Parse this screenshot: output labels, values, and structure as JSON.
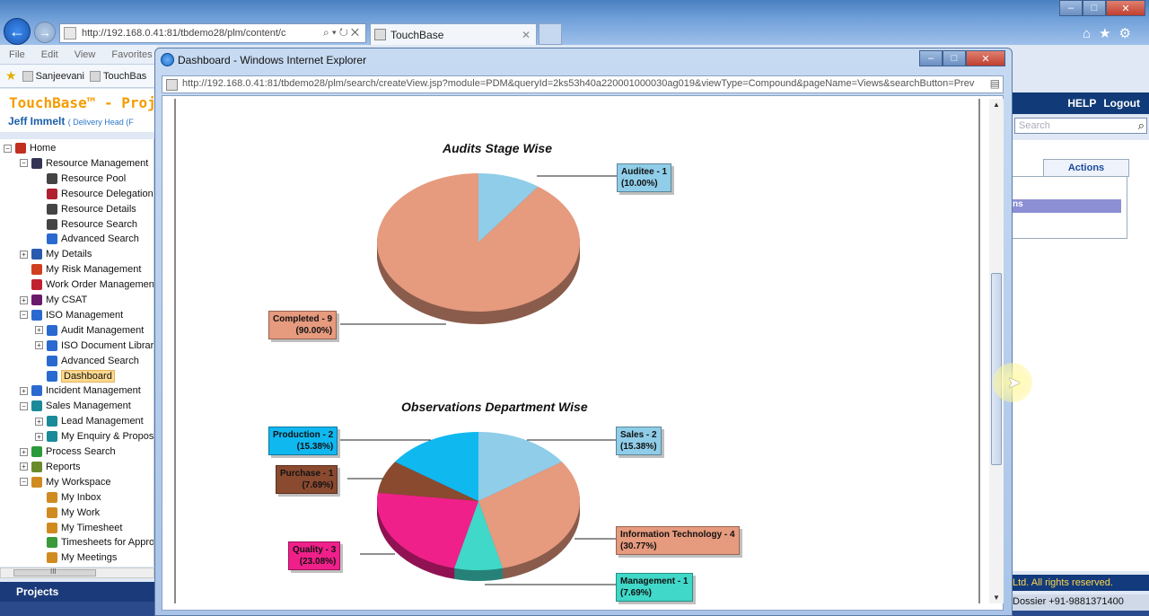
{
  "browser": {
    "address": "http://192.168.0.41:81/tbdemo28/plm/content/c",
    "tab_title": "TouchBase",
    "menu": [
      "File",
      "Edit",
      "View",
      "Favorites"
    ],
    "favorites": [
      "Sanjeevani",
      "TouchBas"
    ],
    "right_icons": [
      "home-icon",
      "star-icon",
      "gear-icon"
    ]
  },
  "app": {
    "brand": "TouchBase™ - Proje",
    "user_name": "Jeff Immelt",
    "user_role": "( Delivery Head (F",
    "help": "HELP",
    "logout": "Logout",
    "search_placeholder": "Search",
    "actions_label": "Actions",
    "actions_highlight": "ns",
    "projects_tab": "Projects",
    "copyright": "Ltd. All rights reserved.",
    "dossier": "Dossier +91-9881371400",
    "scroll_glyph": "III"
  },
  "tree": [
    {
      "label": "Home",
      "icon": "home-icon",
      "color": "#c03020",
      "level": 0,
      "toggle": "−"
    },
    {
      "label": "Resource Management",
      "icon": "resource-management-icon",
      "color": "#333355",
      "level": 1,
      "toggle": "−"
    },
    {
      "label": "Resource Pool",
      "icon": "people-icon",
      "color": "#444",
      "level": 2,
      "toggle": ""
    },
    {
      "label": "Resource Delegation",
      "icon": "delegation-icon",
      "color": "#b02030",
      "level": 2,
      "toggle": ""
    },
    {
      "label": "Resource Details",
      "icon": "people-icon",
      "color": "#444",
      "level": 2,
      "toggle": ""
    },
    {
      "label": "Resource Search",
      "icon": "people-icon",
      "color": "#444",
      "level": 2,
      "toggle": ""
    },
    {
      "label": "Advanced Search",
      "icon": "search-icon",
      "color": "#2a6ad0",
      "level": 2,
      "toggle": ""
    },
    {
      "label": "My Details",
      "icon": "details-icon",
      "color": "#2a5ab0",
      "level": 1,
      "toggle": "+"
    },
    {
      "label": "My Risk Management",
      "icon": "risk-icon",
      "color": "#d04020",
      "level": 1,
      "toggle": ""
    },
    {
      "label": "Work Order Management",
      "icon": "work-order-icon",
      "color": "#c02030",
      "level": 1,
      "toggle": ""
    },
    {
      "label": "My CSAT",
      "icon": "csat-icon",
      "color": "#6a1a6a",
      "level": 1,
      "toggle": "+"
    },
    {
      "label": "ISO Management",
      "icon": "iso-icon",
      "color": "#2a6ad0",
      "level": 1,
      "toggle": "−"
    },
    {
      "label": "Audit Management",
      "icon": "audit-icon",
      "color": "#2a6ad0",
      "level": 2,
      "toggle": "+"
    },
    {
      "label": "ISO Document Library",
      "icon": "document-icon",
      "color": "#2a6ad0",
      "level": 2,
      "toggle": "+"
    },
    {
      "label": "Advanced Search",
      "icon": "search-icon",
      "color": "#2a6ad0",
      "level": 2,
      "toggle": ""
    },
    {
      "label": "Dashboard",
      "icon": "dashboard-icon",
      "color": "#2a6ad0",
      "level": 2,
      "toggle": "",
      "selected": true
    },
    {
      "label": "Incident Management",
      "icon": "incident-icon",
      "color": "#2a6ad0",
      "level": 1,
      "toggle": "+"
    },
    {
      "label": "Sales Management",
      "icon": "sales-icon",
      "color": "#1a8a9a",
      "level": 1,
      "toggle": "−"
    },
    {
      "label": "Lead Management",
      "icon": "lead-icon",
      "color": "#1a8a9a",
      "level": 2,
      "toggle": "+"
    },
    {
      "label": "My Enquiry & Proposa",
      "icon": "enquiry-icon",
      "color": "#1a8a9a",
      "level": 2,
      "toggle": "+"
    },
    {
      "label": "Process Search",
      "icon": "process-icon",
      "color": "#2a9a3a",
      "level": 1,
      "toggle": "+"
    },
    {
      "label": "Reports",
      "icon": "reports-icon",
      "color": "#6a8a2a",
      "level": 1,
      "toggle": "+"
    },
    {
      "label": "My Workspace",
      "icon": "workspace-icon",
      "color": "#d08a20",
      "level": 1,
      "toggle": "−"
    },
    {
      "label": "My Inbox",
      "icon": "inbox-icon",
      "color": "#d08a20",
      "level": 2,
      "toggle": ""
    },
    {
      "label": "My Work",
      "icon": "work-icon",
      "color": "#d08a20",
      "level": 2,
      "toggle": ""
    },
    {
      "label": "My Timesheet",
      "icon": "timesheet-icon",
      "color": "#d08a20",
      "level": 2,
      "toggle": ""
    },
    {
      "label": "Timesheets for Approv",
      "icon": "approval-icon",
      "color": "#3a9a3a",
      "level": 2,
      "toggle": ""
    },
    {
      "label": "My Meetings",
      "icon": "meetings-icon",
      "color": "#d08a20",
      "level": 2,
      "toggle": ""
    }
  ],
  "popup": {
    "title": "Dashboard - Windows Internet Explorer",
    "address": "http://192.168.0.41:81/tbdemo28/plm/search/createView.jsp?module=PDM&queryId=2ks53h40a220001000030ag019&viewType=Compound&pageName=Views&searchButton=Prev"
  },
  "chart_data": [
    {
      "type": "pie",
      "title": "Audits Stage Wise",
      "slices": [
        {
          "label": "Auditee - 1",
          "value": 1,
          "percent": "(10.00%)",
          "color": "#8fcde8"
        },
        {
          "label": "Completed - 9",
          "value": 9,
          "percent": "(90.00%)",
          "color": "#e69a7e"
        }
      ]
    },
    {
      "type": "pie",
      "title": "Observations Department Wise",
      "slices": [
        {
          "label": "Sales - 2",
          "value": 2,
          "percent": "(15.38%)",
          "color": "#8fcde8"
        },
        {
          "label": "Information Technology - 4",
          "value": 4,
          "percent": "(30.77%)",
          "color": "#e69a7e"
        },
        {
          "label": "Management - 1",
          "value": 1,
          "percent": "(7.69%)",
          "color": "#40d8c8"
        },
        {
          "label": "Quality - 3",
          "value": 3,
          "percent": "(23.08%)",
          "color": "#f0208a"
        },
        {
          "label": "Purchase - 1",
          "value": 1,
          "percent": "(7.69%)",
          "color": "#8a4a30"
        },
        {
          "label": "Production - 2",
          "value": 2,
          "percent": "(15.38%)",
          "color": "#10b8f0"
        }
      ]
    }
  ]
}
